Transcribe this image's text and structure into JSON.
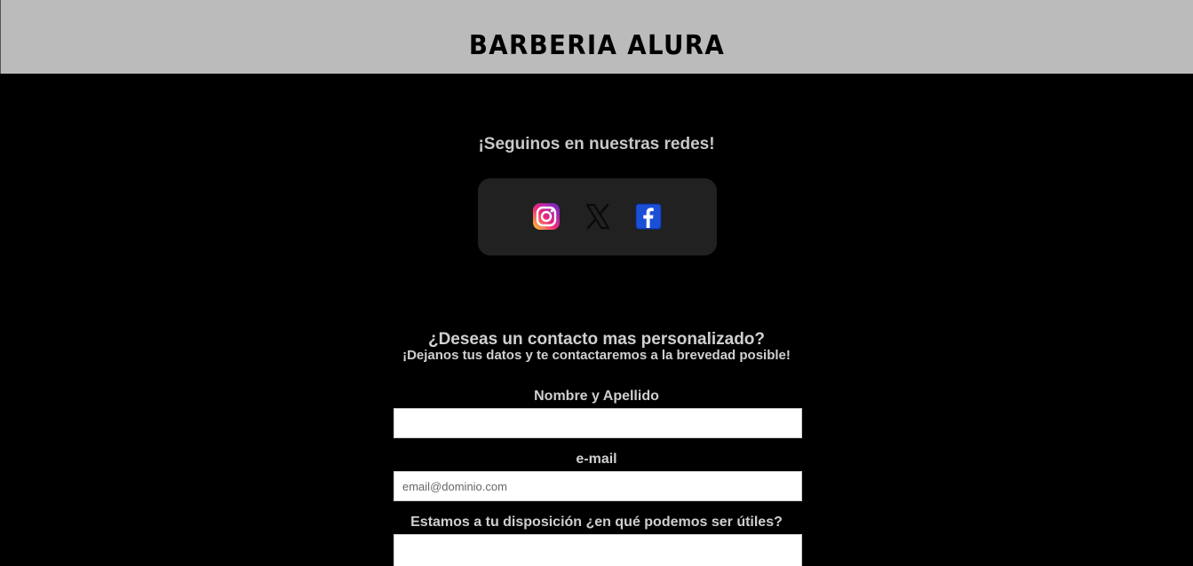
{
  "header": {
    "brand": "BARBERIA ALURA"
  },
  "social": {
    "title": "¡Seguinos en nuestras redes!",
    "icons": [
      {
        "name": "instagram-icon",
        "color": "#e1306c"
      },
      {
        "name": "x-icon",
        "color": "#111111"
      },
      {
        "name": "facebook-icon",
        "color": "#1877f2"
      }
    ]
  },
  "contact": {
    "title": "¿Deseas un contacto mas personalizado?",
    "subtitle": "¡Dejanos tus datos y te contactaremos a la brevedad posible!",
    "name_label": "Nombre y Apellido",
    "name_value": "",
    "email_label": "e-mail",
    "email_placeholder": "email@dominio.com",
    "message_label": "Estamos a tu disposición ¿en qué podemos ser útiles?",
    "message_value": ""
  },
  "colors": {
    "header_bg": "#bbbbbb",
    "page_bg": "#000000",
    "social_box_bg": "#212121",
    "text": "#d0d0d0"
  }
}
